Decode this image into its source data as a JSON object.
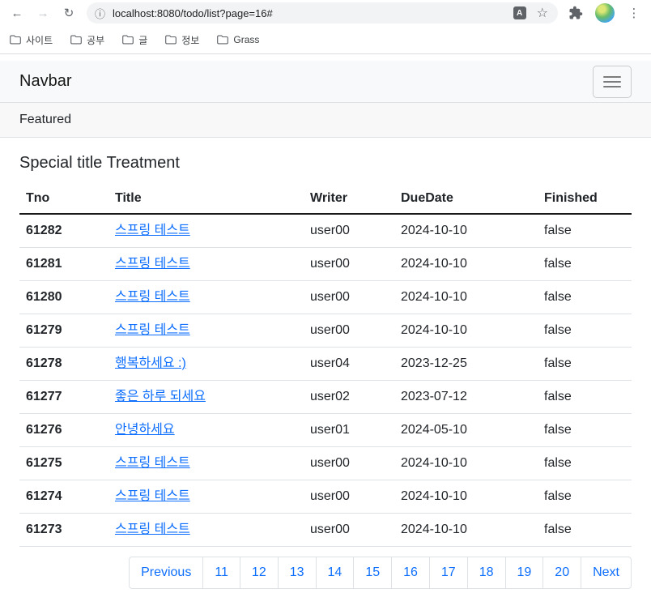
{
  "browser": {
    "url": "localhost:8080/todo/list?page=16#",
    "bookmarks": [
      "사이트",
      "공부",
      "글",
      "정보",
      "Grass"
    ],
    "translate_glyph": "A"
  },
  "page": {
    "navbar_brand": "Navbar",
    "card_header": "Featured",
    "card_title": "Special title Treatment"
  },
  "table": {
    "headers": {
      "tno": "Tno",
      "title": "Title",
      "writer": "Writer",
      "due": "DueDate",
      "finished": "Finished"
    },
    "rows": [
      {
        "tno": "61282",
        "title": "스프링 테스트",
        "writer": "user00",
        "due": "2024-10-10",
        "finished": "false"
      },
      {
        "tno": "61281",
        "title": "스프링 테스트",
        "writer": "user00",
        "due": "2024-10-10",
        "finished": "false"
      },
      {
        "tno": "61280",
        "title": "스프링 테스트",
        "writer": "user00",
        "due": "2024-10-10",
        "finished": "false"
      },
      {
        "tno": "61279",
        "title": "스프링 테스트",
        "writer": "user00",
        "due": "2024-10-10",
        "finished": "false"
      },
      {
        "tno": "61278",
        "title": "행복하세요 :)",
        "writer": "user04",
        "due": "2023-12-25",
        "finished": "false"
      },
      {
        "tno": "61277",
        "title": "좋은 하루 되세요",
        "writer": "user02",
        "due": "2023-07-12",
        "finished": "false"
      },
      {
        "tno": "61276",
        "title": "안녕하세요",
        "writer": "user01",
        "due": "2024-05-10",
        "finished": "false"
      },
      {
        "tno": "61275",
        "title": "스프링 테스트",
        "writer": "user00",
        "due": "2024-10-10",
        "finished": "false"
      },
      {
        "tno": "61274",
        "title": "스프링 테스트",
        "writer": "user00",
        "due": "2024-10-10",
        "finished": "false"
      },
      {
        "tno": "61273",
        "title": "스프링 테스트",
        "writer": "user00",
        "due": "2024-10-10",
        "finished": "false"
      }
    ]
  },
  "pagination": {
    "items": [
      "Previous",
      "11",
      "12",
      "13",
      "14",
      "15",
      "16",
      "17",
      "18",
      "19",
      "20",
      "Next"
    ]
  },
  "colors": {
    "link": "#0d6efd",
    "border": "#dee2e6",
    "text": "#212529",
    "navbar_bg": "#f8f9fa",
    "header_bg": "#f8f8f8"
  }
}
